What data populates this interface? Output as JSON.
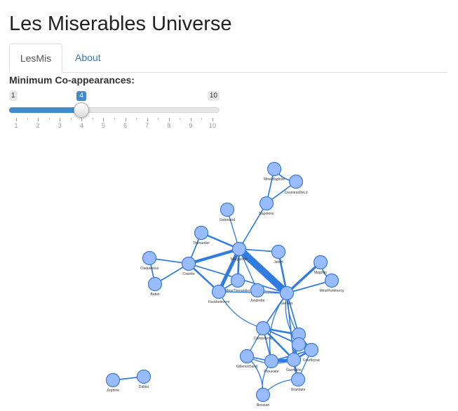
{
  "app": {
    "title": "Les Miserables Universe"
  },
  "tabs": [
    {
      "label": "LesMis",
      "active": true
    },
    {
      "label": "About",
      "active": false
    }
  ],
  "control": {
    "label": "Minimum Co-appearances:",
    "min": 1,
    "max": 10,
    "value": 4,
    "min_label": "1",
    "max_label": "10",
    "value_label": "4",
    "ticks": [
      "1",
      "2",
      "3",
      "4",
      "5",
      "6",
      "7",
      "8",
      "9",
      "10"
    ]
  },
  "colors": {
    "accent": "#428bca",
    "node_fill": "#99bbff",
    "link": "#2f7be0",
    "tab_link": "#337ab7"
  },
  "network": {
    "nodes": [
      {
        "id": "MmeMagloire",
        "label": "MmeMagloire"
      },
      {
        "id": "CountessDeLo",
        "label": "CountessDeLo"
      },
      {
        "id": "Napoleon",
        "label": "Napoleon"
      },
      {
        "id": "Geborand",
        "label": "Geborand"
      },
      {
        "id": "Thenardier",
        "label": "Thenardier"
      },
      {
        "id": "Marguerite",
        "label": "Marguerite"
      },
      {
        "id": "Javert",
        "label": "Javert"
      },
      {
        "id": "Claquesous",
        "label": "Claquesous"
      },
      {
        "id": "Cosette",
        "label": "Cosette"
      },
      {
        "id": "Babet",
        "label": "Babet"
      },
      {
        "id": "Fauchelevent",
        "label": "Fauchelevent"
      },
      {
        "id": "MmeThenardier",
        "label": "MmeThenardier"
      },
      {
        "id": "Jondrette",
        "label": "Jondrette"
      },
      {
        "id": "Gervais",
        "label": "Gervais"
      },
      {
        "id": "Magnon",
        "label": "Magnon"
      },
      {
        "id": "MmePontmercy",
        "label": "MmePontmercy"
      },
      {
        "id": "Combeferre",
        "label": "Combeferre"
      },
      {
        "id": "Enjolras",
        "label": ""
      },
      {
        "id": "Gillenormand",
        "label": "Gillenormand"
      },
      {
        "id": "Prouvaire",
        "label": "Prouvaire"
      },
      {
        "id": "Gavroche",
        "label": "Gavroche"
      },
      {
        "id": "Courfeyrac",
        "label": "Courfeyrac"
      },
      {
        "id": "Bahorel",
        "label": ""
      },
      {
        "id": "Grantaire",
        "label": "Grantaire"
      },
      {
        "id": "Bossuet",
        "label": "Bossuet"
      },
      {
        "id": "Zephine",
        "label": "Zephine"
      },
      {
        "id": "Dahlia",
        "label": "Dahlia"
      }
    ],
    "links": [
      {
        "source": "MmeMagloire",
        "target": "CountessDeLo",
        "weight": 2
      },
      {
        "source": "MmeMagloire",
        "target": "Napoleon",
        "weight": 2
      },
      {
        "source": "CountessDeLo",
        "target": "Napoleon",
        "weight": 2
      },
      {
        "source": "Napoleon",
        "target": "Marguerite",
        "weight": 2
      },
      {
        "source": "Geborand",
        "target": "Marguerite",
        "weight": 1
      },
      {
        "source": "Thenardier",
        "target": "Marguerite",
        "weight": 3
      },
      {
        "source": "Thenardier",
        "target": "Cosette",
        "weight": 2
      },
      {
        "source": "Marguerite",
        "target": "Javert",
        "weight": 2
      },
      {
        "source": "Marguerite",
        "target": "Gervais",
        "weight": 12
      },
      {
        "source": "Marguerite",
        "target": "Cosette",
        "weight": 5
      },
      {
        "source": "Marguerite",
        "target": "Fauchelevent",
        "weight": 6
      },
      {
        "source": "Marguerite",
        "target": "MmeThenardier",
        "weight": 3
      },
      {
        "source": "Marguerite",
        "target": "Jondrette",
        "weight": 1
      },
      {
        "source": "Javert",
        "target": "Gervais",
        "weight": 3
      },
      {
        "source": "Claquesous",
        "target": "Cosette",
        "weight": 2
      },
      {
        "source": "Claquesous",
        "target": "Babet",
        "weight": 2
      },
      {
        "source": "Babet",
        "target": "Cosette",
        "weight": 2
      },
      {
        "source": "Cosette",
        "target": "Fauchelevent",
        "weight": 3
      },
      {
        "source": "Cosette",
        "target": "Gervais",
        "weight": 2
      },
      {
        "source": "Fauchelevent",
        "target": "MmeThenardier",
        "weight": 2
      },
      {
        "source": "Fauchelevent",
        "target": "Gervais",
        "weight": 1
      },
      {
        "source": "Fauchelevent",
        "target": "Combeferre",
        "weight": 1
      },
      {
        "source": "Jondrette",
        "target": "Gervais",
        "weight": 1
      },
      {
        "source": "Gervais",
        "target": "Magnon",
        "weight": 4
      },
      {
        "source": "Gervais",
        "target": "MmePontmercy",
        "weight": 2
      },
      {
        "source": "Magnon",
        "target": "MmePontmercy",
        "weight": 2
      },
      {
        "source": "Gervais",
        "target": "Combeferre",
        "weight": 2
      },
      {
        "source": "Gervais",
        "target": "Enjolras",
        "weight": 2
      },
      {
        "source": "Gervais",
        "target": "Gavroche",
        "weight": 2
      },
      {
        "source": "Gervais",
        "target": "Bahorel",
        "weight": 1
      },
      {
        "source": "Gervais",
        "target": "Prouvaire",
        "weight": 1
      },
      {
        "source": "Gervais",
        "target": "Courfeyrac",
        "weight": 1
      },
      {
        "source": "Combeferre",
        "target": "Enjolras",
        "weight": 3
      },
      {
        "source": "Combeferre",
        "target": "Gavroche",
        "weight": 3
      },
      {
        "source": "Combeferre",
        "target": "Courfeyrac",
        "weight": 2
      },
      {
        "source": "Combeferre",
        "target": "Prouvaire",
        "weight": 2
      },
      {
        "source": "Combeferre",
        "target": "Bahorel",
        "weight": 2
      },
      {
        "source": "Combeferre",
        "target": "Gillenormand",
        "weight": 1
      },
      {
        "source": "Enjolras",
        "target": "Courfeyrac",
        "weight": 2
      },
      {
        "source": "Enjolras",
        "target": "Bahorel",
        "weight": 2
      },
      {
        "source": "Enjolras",
        "target": "Gavroche",
        "weight": 3
      },
      {
        "source": "Enjolras",
        "target": "Grantaire",
        "weight": 1
      },
      {
        "source": "Gillenormand",
        "target": "Prouvaire",
        "weight": 2
      },
      {
        "source": "Gillenormand",
        "target": "Gavroche",
        "weight": 1
      },
      {
        "source": "Prouvaire",
        "target": "Gavroche",
        "weight": 5
      },
      {
        "source": "Prouvaire",
        "target": "Courfeyrac",
        "weight": 2
      },
      {
        "source": "Prouvaire",
        "target": "Bossuet",
        "weight": 1
      },
      {
        "source": "Gavroche",
        "target": "Courfeyrac",
        "weight": 3
      },
      {
        "source": "Gavroche",
        "target": "Bahorel",
        "weight": 2
      },
      {
        "source": "Gavroche",
        "target": "Grantaire",
        "weight": 2
      },
      {
        "source": "Bahorel",
        "target": "Courfeyrac",
        "weight": 2
      },
      {
        "source": "Courfeyrac",
        "target": "Grantaire",
        "weight": 1
      },
      {
        "source": "Grantaire",
        "target": "Bossuet",
        "weight": 1
      },
      {
        "source": "Bossuet",
        "target": "Gillenormand",
        "weight": 1
      },
      {
        "source": "Zephine",
        "target": "Dahlia",
        "weight": 2
      }
    ]
  }
}
